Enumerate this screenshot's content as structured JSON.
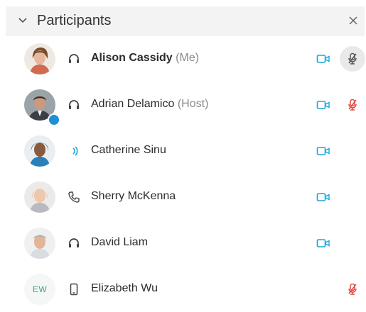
{
  "header": {
    "title": "Participants"
  },
  "participants": [
    {
      "name": "Alison Cassidy",
      "suffix": "(Me)",
      "bold": true,
      "status": "headset",
      "video": true,
      "mute": "gray",
      "avatar": "photo"
    },
    {
      "name": "Adrian Delamico",
      "suffix": "(Host)",
      "bold": false,
      "status": "headset",
      "video": true,
      "mute": "red",
      "avatar": "photo"
    },
    {
      "name": "Catherine Sinu",
      "suffix": "",
      "bold": false,
      "status": "speaking",
      "video": true,
      "mute": "none",
      "avatar": "photo"
    },
    {
      "name": "Sherry McKenna",
      "suffix": "",
      "bold": false,
      "status": "phone",
      "video": true,
      "mute": "none",
      "avatar": "photo"
    },
    {
      "name": "David Liam",
      "suffix": "",
      "bold": false,
      "status": "headset",
      "video": true,
      "mute": "none",
      "avatar": "photo"
    },
    {
      "name": "Elizabeth Wu",
      "suffix": "",
      "initials": "EW",
      "bold": false,
      "status": "mobile",
      "video": false,
      "mute": "red",
      "avatar": "initials"
    }
  ],
  "colors": {
    "accent": "#1aa6d9",
    "mute_red": "#e0493f",
    "initials": "#3aa58b",
    "host_badge": "#1d8fd6"
  },
  "icons": {
    "collapse": "chevron-down-icon",
    "close": "close-icon",
    "headset": "headset-icon",
    "speaking": "speaking-icon",
    "phone": "phone-icon",
    "mobile": "mobile-device-icon",
    "video": "video-camera-icon",
    "mute": "microphone-muted-icon"
  }
}
